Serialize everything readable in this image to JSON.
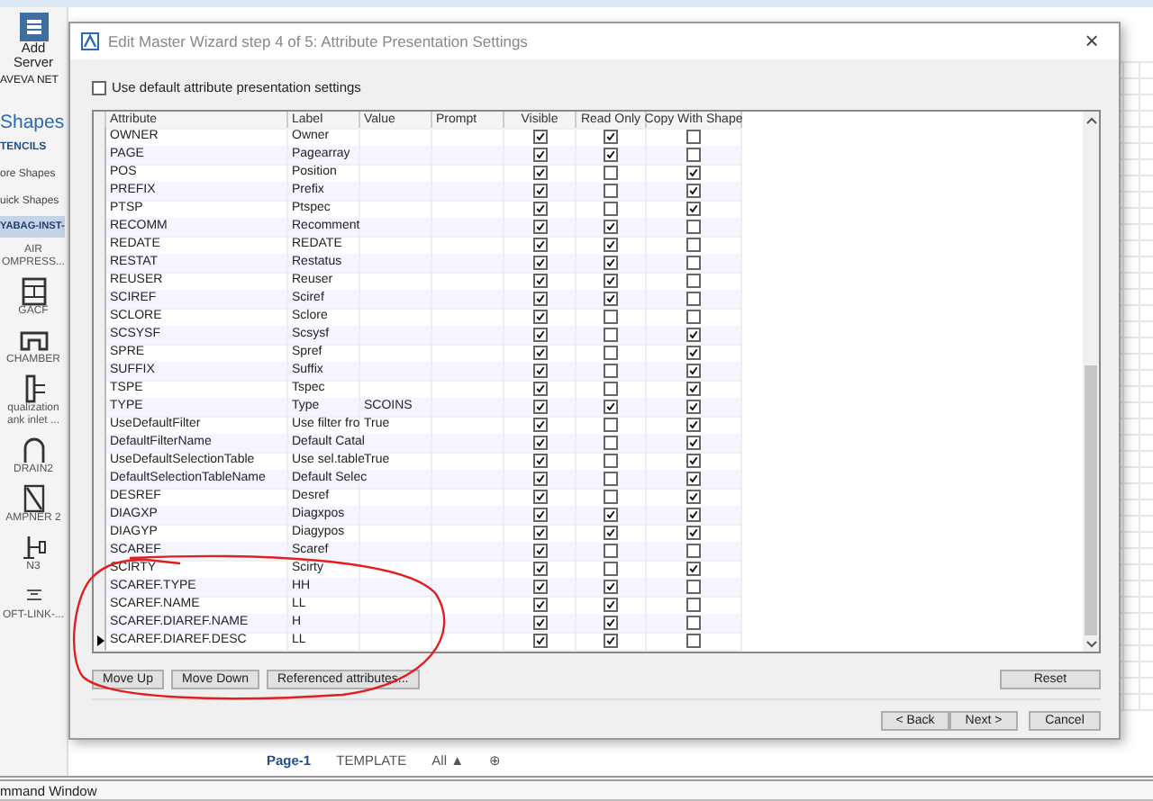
{
  "ribbon": {
    "button": "Add Server",
    "group_label": "AVEVA NET"
  },
  "sidebar": {
    "title": "Shapes",
    "tab": "TENCILS",
    "links": [
      "ore Shapes",
      "uick Shapes"
    ],
    "stencils": [
      {
        "label": "YABAG-INST-",
        "selected": true
      }
    ],
    "shapes": [
      {
        "label": "AIR OMPRESS..."
      },
      {
        "label": "GACF"
      },
      {
        "label": "CHAMBER"
      },
      {
        "label": "qualization ank inlet ..."
      },
      {
        "label": "DRAIN2"
      },
      {
        "label": "AMPNER 2"
      },
      {
        "label": "N3"
      },
      {
        "label": "OFT-LINK-..."
      }
    ]
  },
  "page_tabs": [
    {
      "label": "Page-1",
      "selected": true
    },
    {
      "label": "TEMPLATE",
      "selected": false
    }
  ],
  "page_filter": "All ▲",
  "add_page": "⊕",
  "command_window": "mmand Window",
  "dialog": {
    "title": "Edit Master Wizard step 4 of 5: Attribute Presentation Settings",
    "close": "×",
    "use_default": {
      "label": "Use default attribute presentation settings",
      "checked": false
    },
    "table": {
      "columns": [
        "Attribute",
        "Label",
        "Value",
        "Prompt",
        "Visible",
        "Read Only",
        "Copy With Shape"
      ],
      "rows": [
        {
          "attribute": "OWNER",
          "label": "Owner",
          "visible": true,
          "read_only": true,
          "copy_with_shape": false,
          "selected": false
        },
        {
          "attribute": "PAGE",
          "label": "Pagearray",
          "visible": true,
          "read_only": true,
          "copy_with_shape": false,
          "selected": false
        },
        {
          "attribute": "POS",
          "label": "Position",
          "visible": true,
          "read_only": false,
          "copy_with_shape": true,
          "selected": false
        },
        {
          "attribute": "PREFIX",
          "label": "Prefix",
          "visible": true,
          "read_only": false,
          "copy_with_shape": true,
          "selected": false
        },
        {
          "attribute": "PTSP",
          "label": "Ptspec",
          "visible": true,
          "read_only": false,
          "copy_with_shape": true,
          "selected": false
        },
        {
          "attribute": "RECOMM",
          "label": "Recomment",
          "visible": true,
          "read_only": true,
          "copy_with_shape": false,
          "selected": false
        },
        {
          "attribute": "REDATE",
          "label": "REDATE",
          "visible": true,
          "read_only": true,
          "copy_with_shape": false,
          "selected": false
        },
        {
          "attribute": "RESTAT",
          "label": "Restatus",
          "visible": true,
          "read_only": true,
          "copy_with_shape": false,
          "selected": false
        },
        {
          "attribute": "REUSER",
          "label": "Reuser",
          "visible": true,
          "read_only": true,
          "copy_with_shape": false,
          "selected": false
        },
        {
          "attribute": "SCIREF",
          "label": "Sciref",
          "visible": true,
          "read_only": true,
          "copy_with_shape": false,
          "selected": false
        },
        {
          "attribute": "SCLORE",
          "label": "Sclore",
          "visible": true,
          "read_only": false,
          "copy_with_shape": false,
          "selected": false
        },
        {
          "attribute": "SCSYSF",
          "label": "Scsysf",
          "visible": true,
          "read_only": false,
          "copy_with_shape": true,
          "selected": false
        },
        {
          "attribute": "SPRE",
          "label": "Spref",
          "visible": true,
          "read_only": false,
          "copy_with_shape": true,
          "selected": false
        },
        {
          "attribute": "SUFFIX",
          "label": "Suffix",
          "visible": true,
          "read_only": false,
          "copy_with_shape": true,
          "selected": false
        },
        {
          "attribute": "TSPE",
          "label": "Tspec",
          "visible": true,
          "read_only": false,
          "copy_with_shape": true,
          "selected": false
        },
        {
          "attribute": "TYPE",
          "label": "Type",
          "value": "SCOINS",
          "visible": true,
          "read_only": true,
          "copy_with_shape": true,
          "selected": false
        },
        {
          "attribute": "UseDefaultFilter",
          "label": "Use filter fro",
          "value": "True",
          "visible": true,
          "read_only": false,
          "copy_with_shape": true,
          "selected": false
        },
        {
          "attribute": "DefaultFilterName",
          "label": "Default Catal",
          "visible": true,
          "read_only": false,
          "copy_with_shape": true,
          "selected": false
        },
        {
          "attribute": "UseDefaultSelectionTable",
          "label": "Use sel.table",
          "value": "True",
          "visible": true,
          "read_only": false,
          "copy_with_shape": true,
          "selected": false
        },
        {
          "attribute": "DefaultSelectionTableName",
          "label": "Default Selec",
          "visible": true,
          "read_only": false,
          "copy_with_shape": true,
          "selected": false
        },
        {
          "attribute": "DESREF",
          "label": "Desref",
          "visible": true,
          "read_only": false,
          "copy_with_shape": true,
          "selected": false
        },
        {
          "attribute": "DIAGXP",
          "label": "Diagxpos",
          "visible": true,
          "read_only": true,
          "copy_with_shape": true,
          "selected": false
        },
        {
          "attribute": "DIAGYP",
          "label": "Diagypos",
          "visible": true,
          "read_only": true,
          "copy_with_shape": true,
          "selected": false
        },
        {
          "attribute": "SCAREF",
          "label": "Scaref",
          "visible": true,
          "read_only": false,
          "copy_with_shape": false,
          "selected": false
        },
        {
          "attribute": "SCIRTY",
          "label": "Scirty",
          "visible": true,
          "read_only": false,
          "copy_with_shape": true,
          "selected": false
        },
        {
          "attribute": "SCAREF.TYPE",
          "label": "HH",
          "visible": true,
          "read_only": true,
          "copy_with_shape": false,
          "selected": false
        },
        {
          "attribute": "SCAREF.NAME",
          "label": "LL",
          "visible": true,
          "read_only": true,
          "copy_with_shape": false,
          "selected": false
        },
        {
          "attribute": "SCAREF.DIAREF.NAME",
          "label": "H",
          "visible": true,
          "read_only": true,
          "copy_with_shape": false,
          "selected": false
        },
        {
          "attribute": "SCAREF.DIAREF.DESC",
          "label": "LL",
          "visible": true,
          "read_only": true,
          "copy_with_shape": false,
          "selected": true
        }
      ]
    },
    "table_buttons": [
      "Move Up",
      "Move Down",
      "Referenced attributes..."
    ],
    "reset_button": "Reset",
    "nav_buttons": [
      "< Back",
      "Next >",
      "Cancel"
    ]
  }
}
